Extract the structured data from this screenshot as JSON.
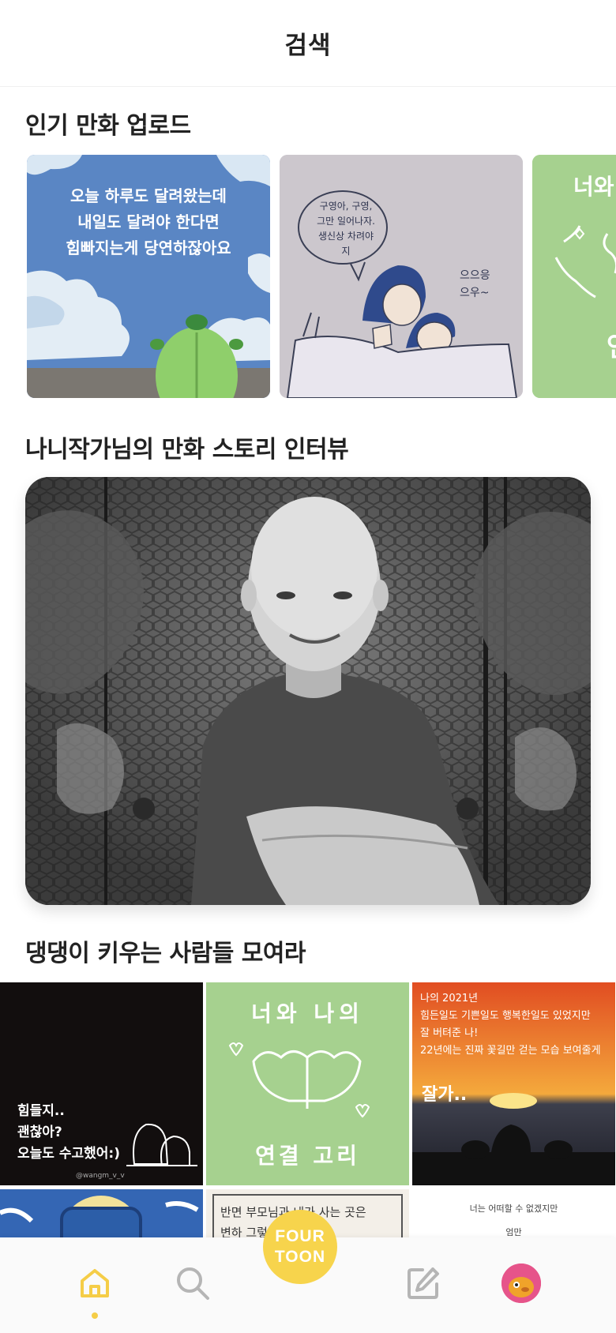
{
  "header": {
    "title": "검색"
  },
  "popular": {
    "title": "인기 만화 업로드",
    "cards": [
      {
        "lines": [
          "오늘 하루도 달려왔는데",
          "내일도 달려야 한다면",
          "힘빠지는게 당연하잖아요"
        ]
      },
      {
        "bubble": [
          "구영아, 구영,",
          "그만 일어나자.",
          "생신상 차려야지"
        ],
        "sound": [
          "으으응",
          "으우~"
        ]
      },
      {
        "lines": [
          "너와"
        ]
      }
    ]
  },
  "interview": {
    "title": "나니작가님의 만화 스토리 인터뷰"
  },
  "dogs": {
    "title": "댕댕이 키우는 사람들 모여라",
    "tiles": [
      {
        "lines": [
          "힘들지..",
          "괜찮아?",
          "오늘도 수고했어:)"
        ],
        "credit": "@wangm_v_v"
      },
      {
        "top": "너와 나의",
        "bottom": "연결 고리"
      },
      {
        "lines": [
          "나의 2021년",
          "힘든일도 기쁜일도 행복한일도 있었지만",
          "잘 버텨준 나!",
          "22년에는 진짜 꽃길만 걷는 모습 보여줄게"
        ],
        "big": "잘가.."
      },
      {
        "lines": []
      },
      {
        "lines": [
          "반면 부모님과 내가 사는 곳은",
          "변하 그렇지 않다"
        ]
      },
      {
        "lines": [
          "너는 어떠할 수 없겠지만",
          "엄만"
        ]
      }
    ]
  },
  "nav": {
    "fab_line1": "FOUR",
    "fab_line2": "TOON",
    "items": [
      "home-icon",
      "search-icon",
      "edit-icon",
      "profile-avatar"
    ],
    "active_color": "#f5cd47"
  }
}
